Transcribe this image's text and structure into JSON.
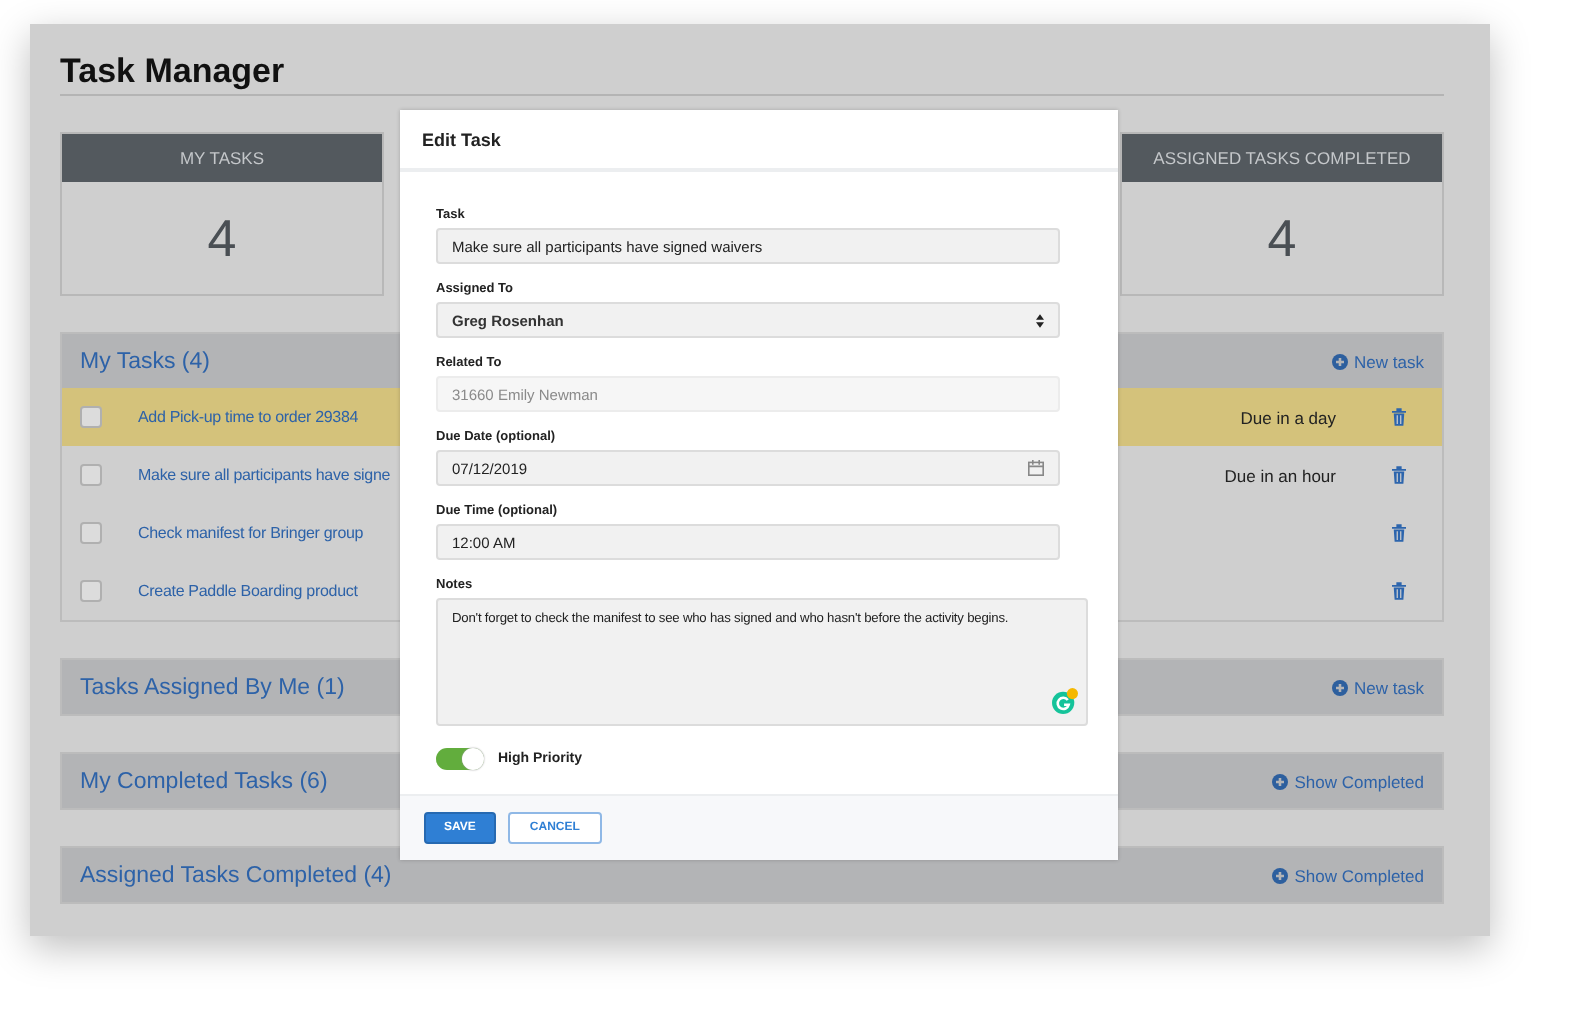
{
  "page": {
    "title": "Task Manager"
  },
  "stat_cards": [
    {
      "label": "MY TASKS",
      "value": "4"
    },
    {
      "label": "ASSIGNED TASKS COMPLETED",
      "value": "4"
    }
  ],
  "sections": [
    {
      "title": "My Tasks (4)",
      "action": {
        "label": "New task"
      },
      "tasks": [
        {
          "text": "Add Pick-up time to order 29384",
          "checked": false,
          "highlighted": true,
          "due": "Due in a day"
        },
        {
          "text": "Make sure all participants have signe",
          "checked": false,
          "highlighted": false,
          "due": "Due in an hour"
        },
        {
          "text": "Check manifest for Bringer group",
          "checked": false,
          "highlighted": false
        },
        {
          "text": "Create Paddle Boarding product",
          "checked": false,
          "highlighted": false
        }
      ]
    },
    {
      "title": "Tasks Assigned By Me (1)",
      "action": {
        "label": "New task"
      }
    },
    {
      "title": "My Completed Tasks (6)",
      "action": {
        "label": "Show Completed"
      }
    },
    {
      "title": "Assigned Tasks Completed (4)",
      "action": {
        "label": "Show Completed"
      }
    }
  ],
  "modal": {
    "title": "Edit Task",
    "fields": [
      {
        "label": "Task",
        "kind": "text",
        "value": "Make sure all participants have signed waivers"
      },
      {
        "label": "Assigned To",
        "kind": "select",
        "value": "Greg Rosenhan"
      },
      {
        "label": "Related To",
        "kind": "readonly",
        "value": "31660 Emily Newman"
      },
      {
        "label": "Due Date (optional)",
        "kind": "date",
        "value": "07/12/2019"
      },
      {
        "label": "Due Time (optional)",
        "kind": "text",
        "value": "12:00 AM"
      },
      {
        "label": "Notes",
        "kind": "textarea",
        "value": "Don't forget to check the manifest to see who has signed and who hasn't before the activity begins."
      }
    ],
    "toggle": {
      "label": "High Priority",
      "on": true
    },
    "buttons": [
      {
        "label": "SAVE",
        "kind": "primary"
      },
      {
        "label": "CANCEL",
        "kind": "secondary"
      }
    ]
  }
}
